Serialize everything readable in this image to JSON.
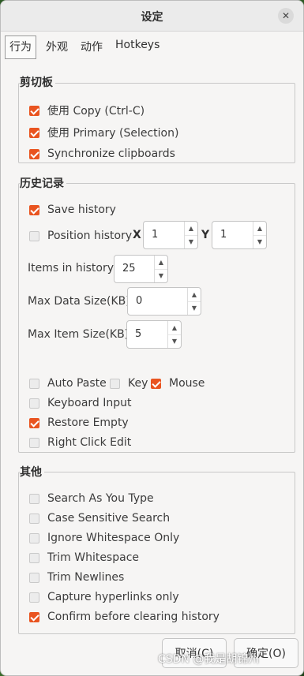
{
  "window": {
    "title": "设定",
    "close_icon": "close-icon"
  },
  "tabs": [
    {
      "label": "行为",
      "active": true
    },
    {
      "label": "外观",
      "active": false
    },
    {
      "label": "动作",
      "active": false
    },
    {
      "label": "Hotkeys",
      "active": false
    }
  ],
  "clipboard": {
    "title": "剪切板",
    "items": [
      {
        "label": "使用 Copy (Ctrl-C)",
        "checked": true
      },
      {
        "label": "使用 Primary (Selection)",
        "checked": true
      },
      {
        "label": "Synchronize clipboards",
        "checked": true
      }
    ]
  },
  "history": {
    "title": "历史记录",
    "save_history": {
      "label": "Save history",
      "checked": true
    },
    "position_history": {
      "label": "Position history",
      "checked": false,
      "x_label": "X",
      "x_value": "1",
      "y_label": "Y",
      "y_value": "1"
    },
    "items_in_history": {
      "label": "Items in history",
      "value": "25"
    },
    "max_data_size": {
      "label": "Max Data Size(KB)",
      "value": "0"
    },
    "max_item_size": {
      "label": "Max Item Size(KB)",
      "value": "5"
    },
    "auto_paste": {
      "label": "Auto Paste",
      "checked": false
    },
    "key": {
      "label": "Key",
      "checked": false
    },
    "mouse": {
      "label": "Mouse",
      "checked": true
    },
    "keyboard_input": {
      "label": "Keyboard Input",
      "checked": false
    },
    "restore_empty": {
      "label": "Restore Empty",
      "checked": true
    },
    "right_click_edit": {
      "label": "Right Click Edit",
      "checked": false
    }
  },
  "other": {
    "title": "其他",
    "items": [
      {
        "label": "Search As You Type",
        "checked": false
      },
      {
        "label": "Case Sensitive Search",
        "checked": false
      },
      {
        "label": "Ignore Whitespace Only",
        "checked": false
      },
      {
        "label": "Trim Whitespace",
        "checked": false
      },
      {
        "label": "Trim Newlines",
        "checked": false
      },
      {
        "label": "Capture hyperlinks only",
        "checked": false
      },
      {
        "label": "Confirm before clearing history",
        "checked": true
      }
    ]
  },
  "buttons": {
    "cancel": "取消(C)",
    "ok": "确定(O)"
  },
  "watermark": "CSDN @我是胡锦州",
  "colors": {
    "accent": "#e95420"
  }
}
